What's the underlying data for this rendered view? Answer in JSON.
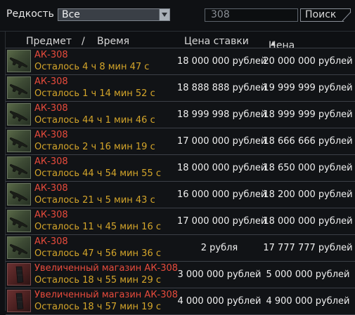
{
  "filter": {
    "rarity_label": "Редкость",
    "rarity_value": "Все",
    "search_value": "308",
    "search_button": "Поиск"
  },
  "columns": {
    "item": "Предмет",
    "separator": "/",
    "time": "Время",
    "bid": "Цена ставки",
    "buyout": "Цена выкупа"
  },
  "rows": [
    {
      "name": "АК-308",
      "time": "Осталось 4 ч 8 мин 47 с",
      "bid": "18 000 000 рублей",
      "buyout": "20 000 000 рублей",
      "icon": "rifle-icon"
    },
    {
      "name": "АК-308",
      "time": "Осталось 1 ч 14 мин 52 с",
      "bid": "18 888 888 рублей",
      "buyout": "19 999 999 рублей",
      "icon": "rifle-icon"
    },
    {
      "name": "АК-308",
      "time": "Осталось 44 ч 1 мин 46 с",
      "bid": "18 999 998 рублей",
      "buyout": "18 999 999 рублей",
      "icon": "rifle-icon"
    },
    {
      "name": "АК-308",
      "time": "Осталось 2 ч 16 мин 19 с",
      "bid": "17 000 000 рублей",
      "buyout": "18 666 666 рублей",
      "icon": "rifle-icon"
    },
    {
      "name": "АК-308",
      "time": "Осталось 44 ч 54 мин 55 с",
      "bid": "18 000 000 рублей",
      "buyout": "18 650 000 рублей",
      "icon": "rifle-icon"
    },
    {
      "name": "АК-308",
      "time": "Осталось 21 ч 5 мин 43 с",
      "bid": "16 000 000 рублей",
      "buyout": "18 200 000 рублей",
      "icon": "rifle-icon"
    },
    {
      "name": "АК-308",
      "time": "Осталось 11 ч 45 мин 16 с",
      "bid": "17 000 000 рублей",
      "buyout": "18 000 000 рублей",
      "icon": "rifle-icon"
    },
    {
      "name": "АК-308",
      "time": "Осталось 47 ч 56 мин 36 с",
      "bid": "2 рубля",
      "buyout": "17 777 777 рублей",
      "icon": "rifle-icon"
    },
    {
      "name": "Увеличенный магазин АК-308",
      "time": "Осталось 18 ч 55 мин 29 с",
      "bid": "3 000 000 рублей",
      "buyout": "5 000 000 рублей",
      "icon": "magazine-icon"
    },
    {
      "name": "Увеличенный магазин АК-308",
      "time": "Осталось 18 ч 57 мин 19 с",
      "bid": "4 000 000 рублей",
      "buyout": "4 900 000 рублей",
      "icon": "magazine-icon"
    }
  ]
}
